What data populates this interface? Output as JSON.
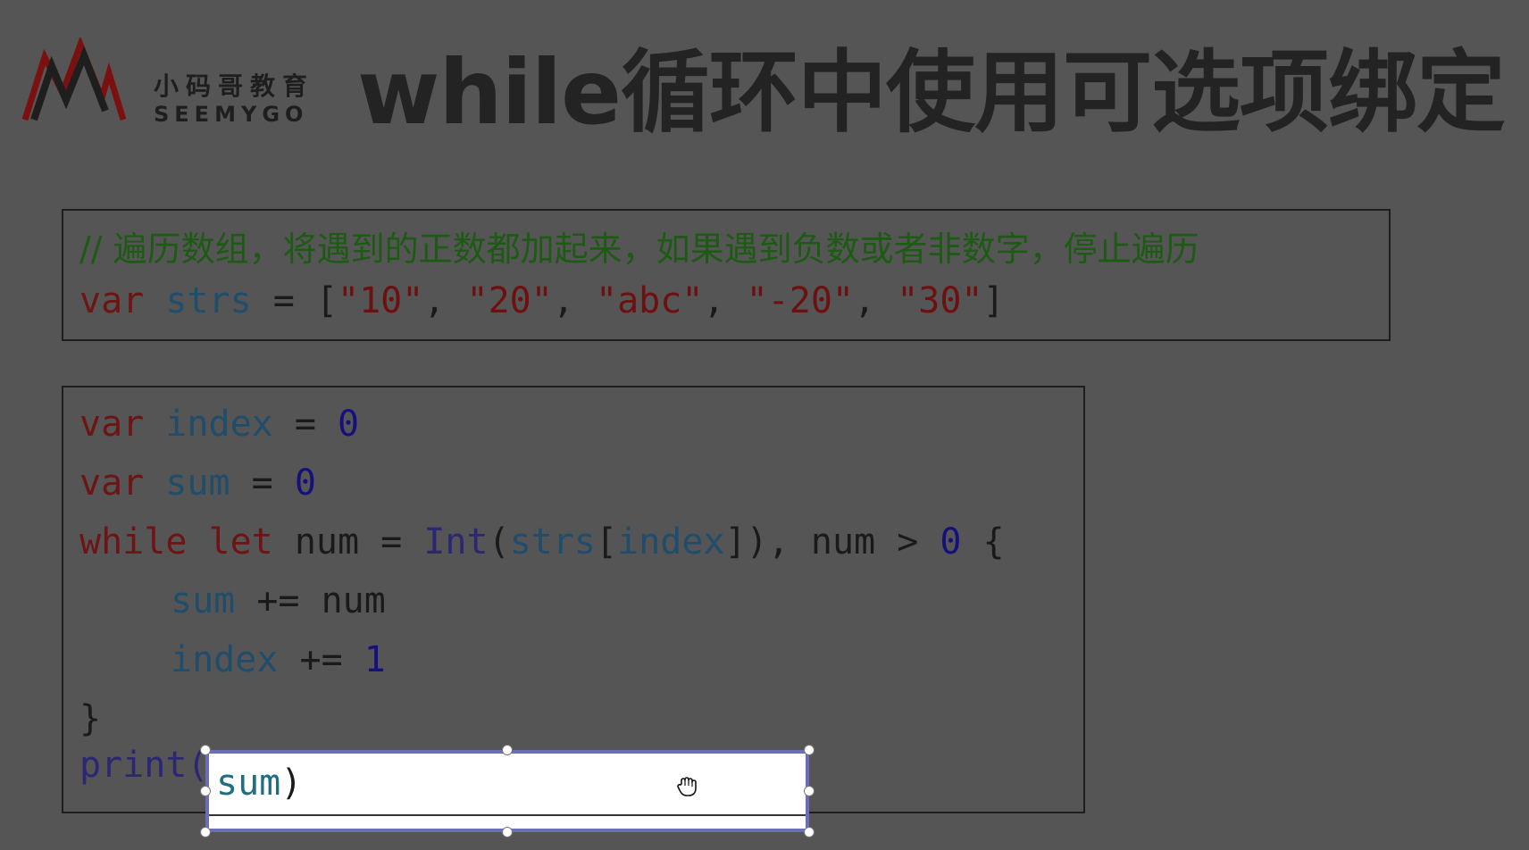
{
  "logo": {
    "cn": "小码哥教育",
    "en": "SEEMYGO",
    "colors": {
      "red": "#7a1010",
      "dark": "#1e1e1e"
    }
  },
  "title": "while循环中使用可选项绑定",
  "box1": {
    "comment": "// 遍历数组，将遇到的正数都加起来，如果遇到负数或者非数字，停止遍历",
    "line2": {
      "kw": "var",
      "name": "strs",
      "op": " = [",
      "items": [
        "\"10\"",
        "\"20\"",
        "\"abc\"",
        "\"-20\"",
        "\"30\""
      ],
      "sep": ", ",
      "close": "]"
    }
  },
  "box2": {
    "lines": [
      {
        "kw": "var",
        "name": "index",
        "op": " = ",
        "val": "0"
      },
      {
        "kw": "var",
        "name": "sum",
        "op": " = ",
        "val": "0"
      },
      {
        "kw1": "while",
        "kw2": "let",
        "rest1": " num = ",
        "fn": "Int",
        "p1": "(",
        "arr": "strs",
        "b1": "[",
        "idx": "index",
        "b2": "]), num > ",
        "zero": "0",
        "brace": " {"
      },
      {
        "name": "sum",
        "rest": " += num"
      },
      {
        "name": "index",
        "op": " += ",
        "val": "1"
      },
      {
        "close": "}"
      },
      {
        "fn": "print("
      }
    ]
  },
  "edit": {
    "text": "sum",
    "close": ")"
  },
  "cursor_icon": "hand-grab-icon"
}
